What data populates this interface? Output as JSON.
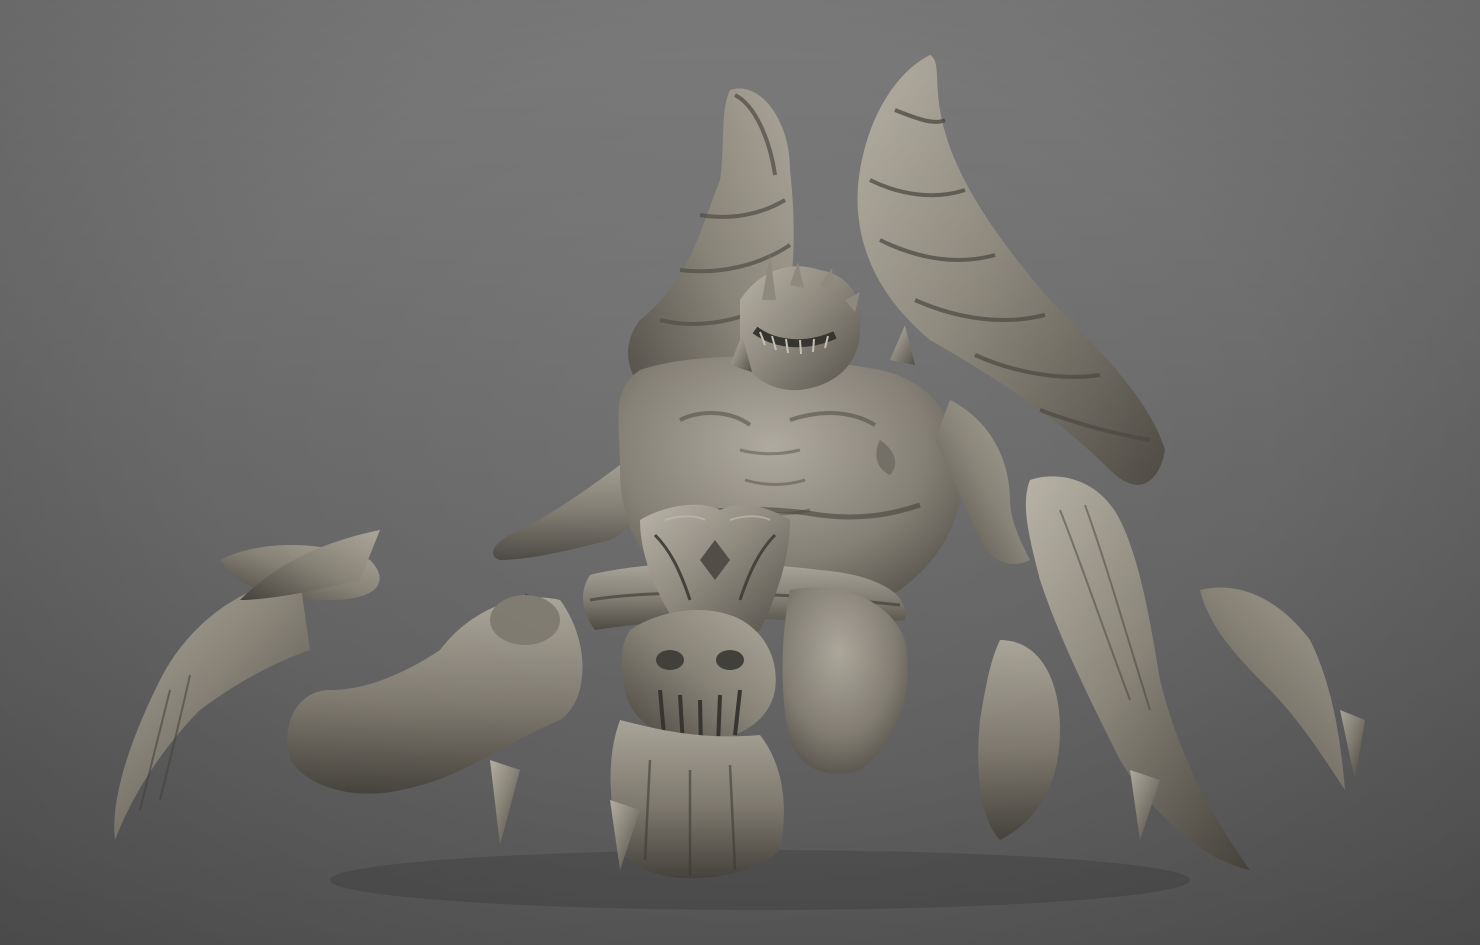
{
  "scene": {
    "subject": "sculpt-creature",
    "background_top": "#7b7b7b",
    "background_bottom": "#5a5a5a",
    "material_base": "#8a8578",
    "material_light": "#b3aea2",
    "material_dark": "#4a4740",
    "material_deep": "#35332e"
  }
}
